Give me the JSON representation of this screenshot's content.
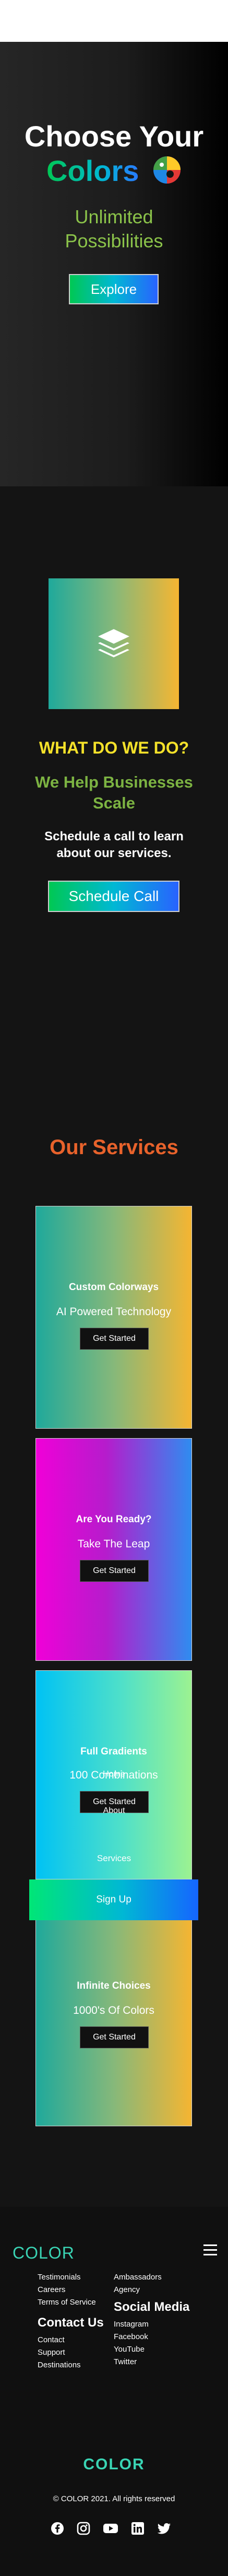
{
  "hero": {
    "title_line1": "Choose Your",
    "title_line2": "Colors",
    "subtitle_line1": "Unlimited",
    "subtitle_line2": "Possibilities",
    "explore_label": "Explore"
  },
  "about": {
    "heading": "WHAT DO WE DO?",
    "tagline_line1": "We Help Businesses",
    "tagline_line2": "Scale",
    "text_line1": "Schedule a call to learn",
    "text_line2": "about our services.",
    "button_label": "Schedule Call"
  },
  "services": {
    "title": "Our Services",
    "cards": [
      {
        "title": "Custom Colorways",
        "subtitle": "AI Powered Technology",
        "button": "Get Started"
      },
      {
        "title": "Are You Ready?",
        "subtitle": "Take The Leap",
        "button": "Get Started"
      },
      {
        "title": "Full Gradients",
        "subtitle": "100 Combinations",
        "button": "Get Started"
      },
      {
        "title": "Infinite Choices",
        "subtitle": "1000's Of Colors",
        "button": "Get Started"
      }
    ],
    "overlay_links": [
      "Home",
      "About",
      "Services"
    ],
    "signup_label": "Sign Up"
  },
  "footer": {
    "logo": "COLOR",
    "links_left": [
      "Testimonials",
      "Careers",
      "Terms of Service"
    ],
    "links_right": [
      "Ambassadors",
      "Agency"
    ],
    "contact_heading": "Contact Us",
    "contact_links": [
      "Contact",
      "Support",
      "Destinations"
    ],
    "social_heading": "Social Media",
    "social_links": [
      "Instagram",
      "Facebook",
      "YouTube",
      "Twitter"
    ],
    "logo_bottom": "COLOR",
    "copyright": "© COLOR 2021. All rights reserved",
    "social_icons": [
      "facebook-icon",
      "instagram-icon",
      "youtube-icon",
      "linkedin-icon",
      "twitter-icon"
    ]
  },
  "colors": {
    "accent_teal": "#3ad4b4",
    "heading_yellow": "#f4e12a",
    "tag_green": "#7cb342",
    "services_orange": "#e8622b"
  }
}
